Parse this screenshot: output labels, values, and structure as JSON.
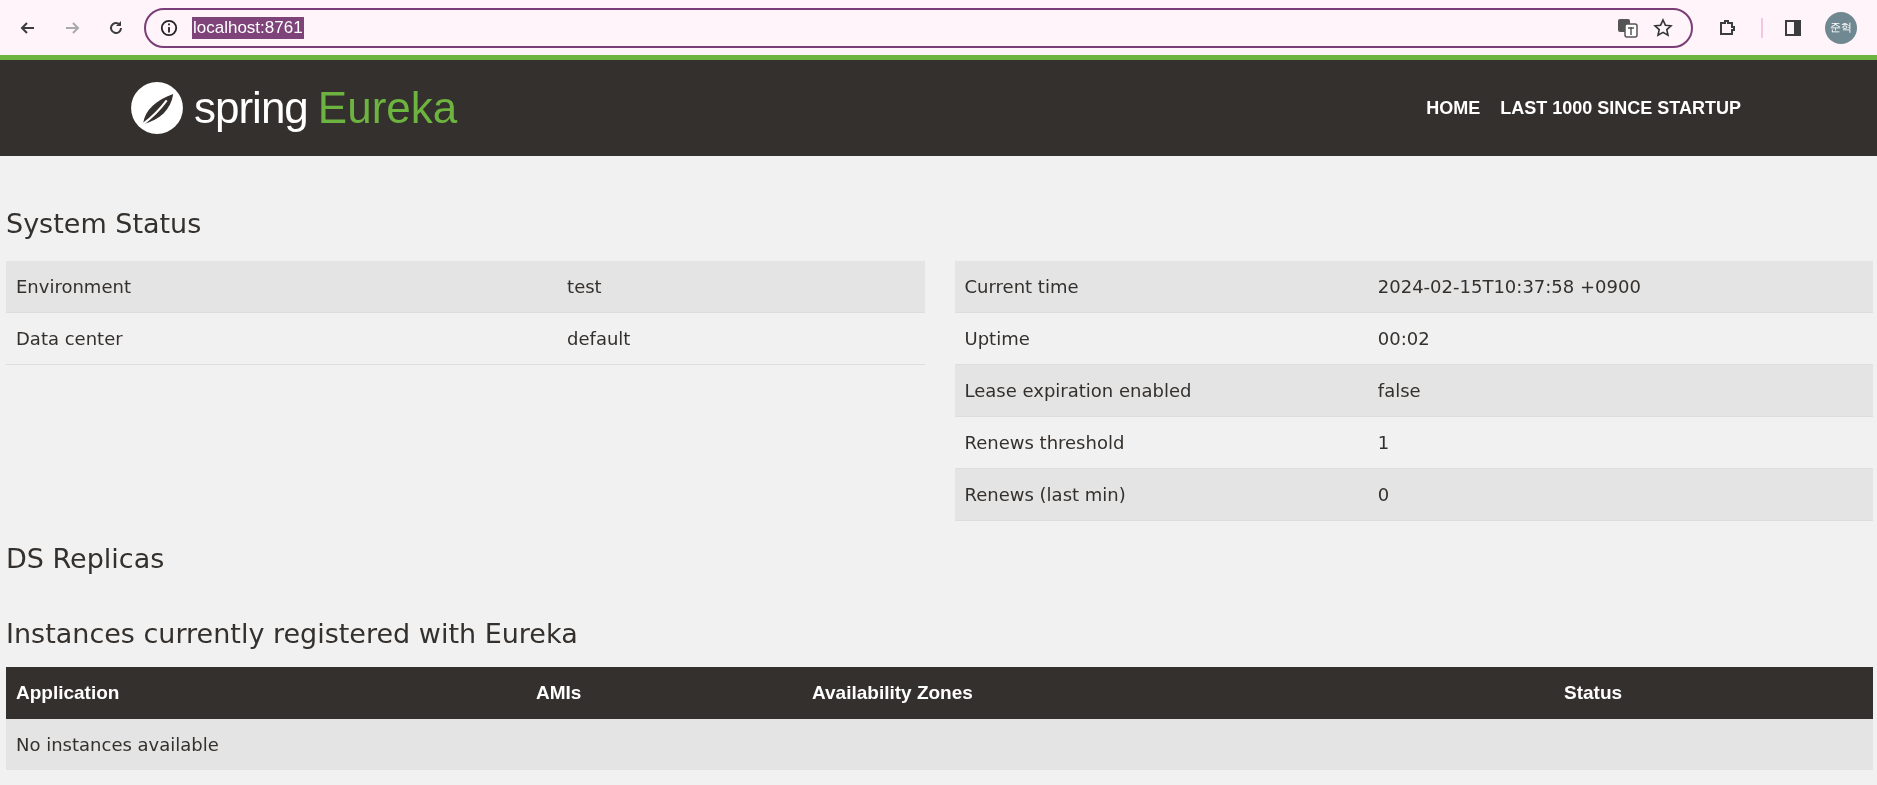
{
  "browser": {
    "url": "localhost:8761",
    "profile": "준혁"
  },
  "header": {
    "brand": "spring",
    "product": "Eureka",
    "nav": [
      {
        "label": "HOME"
      },
      {
        "label": "LAST 1000 SINCE STARTUP"
      }
    ]
  },
  "system_status": {
    "title": "System Status",
    "left": [
      {
        "label": "Environment",
        "value": "test"
      },
      {
        "label": "Data center",
        "value": "default"
      }
    ],
    "right": [
      {
        "label": "Current time",
        "value": "2024-02-15T10:37:58 +0900"
      },
      {
        "label": "Uptime",
        "value": "00:02"
      },
      {
        "label": "Lease expiration enabled",
        "value": "false"
      },
      {
        "label": "Renews threshold",
        "value": "1"
      },
      {
        "label": "Renews (last min)",
        "value": "0"
      }
    ]
  },
  "ds_replicas": {
    "title": "DS Replicas"
  },
  "instances": {
    "title": "Instances currently registered with Eureka",
    "columns": [
      "Application",
      "AMIs",
      "Availability Zones",
      "Status"
    ],
    "empty_message": "No instances available"
  }
}
